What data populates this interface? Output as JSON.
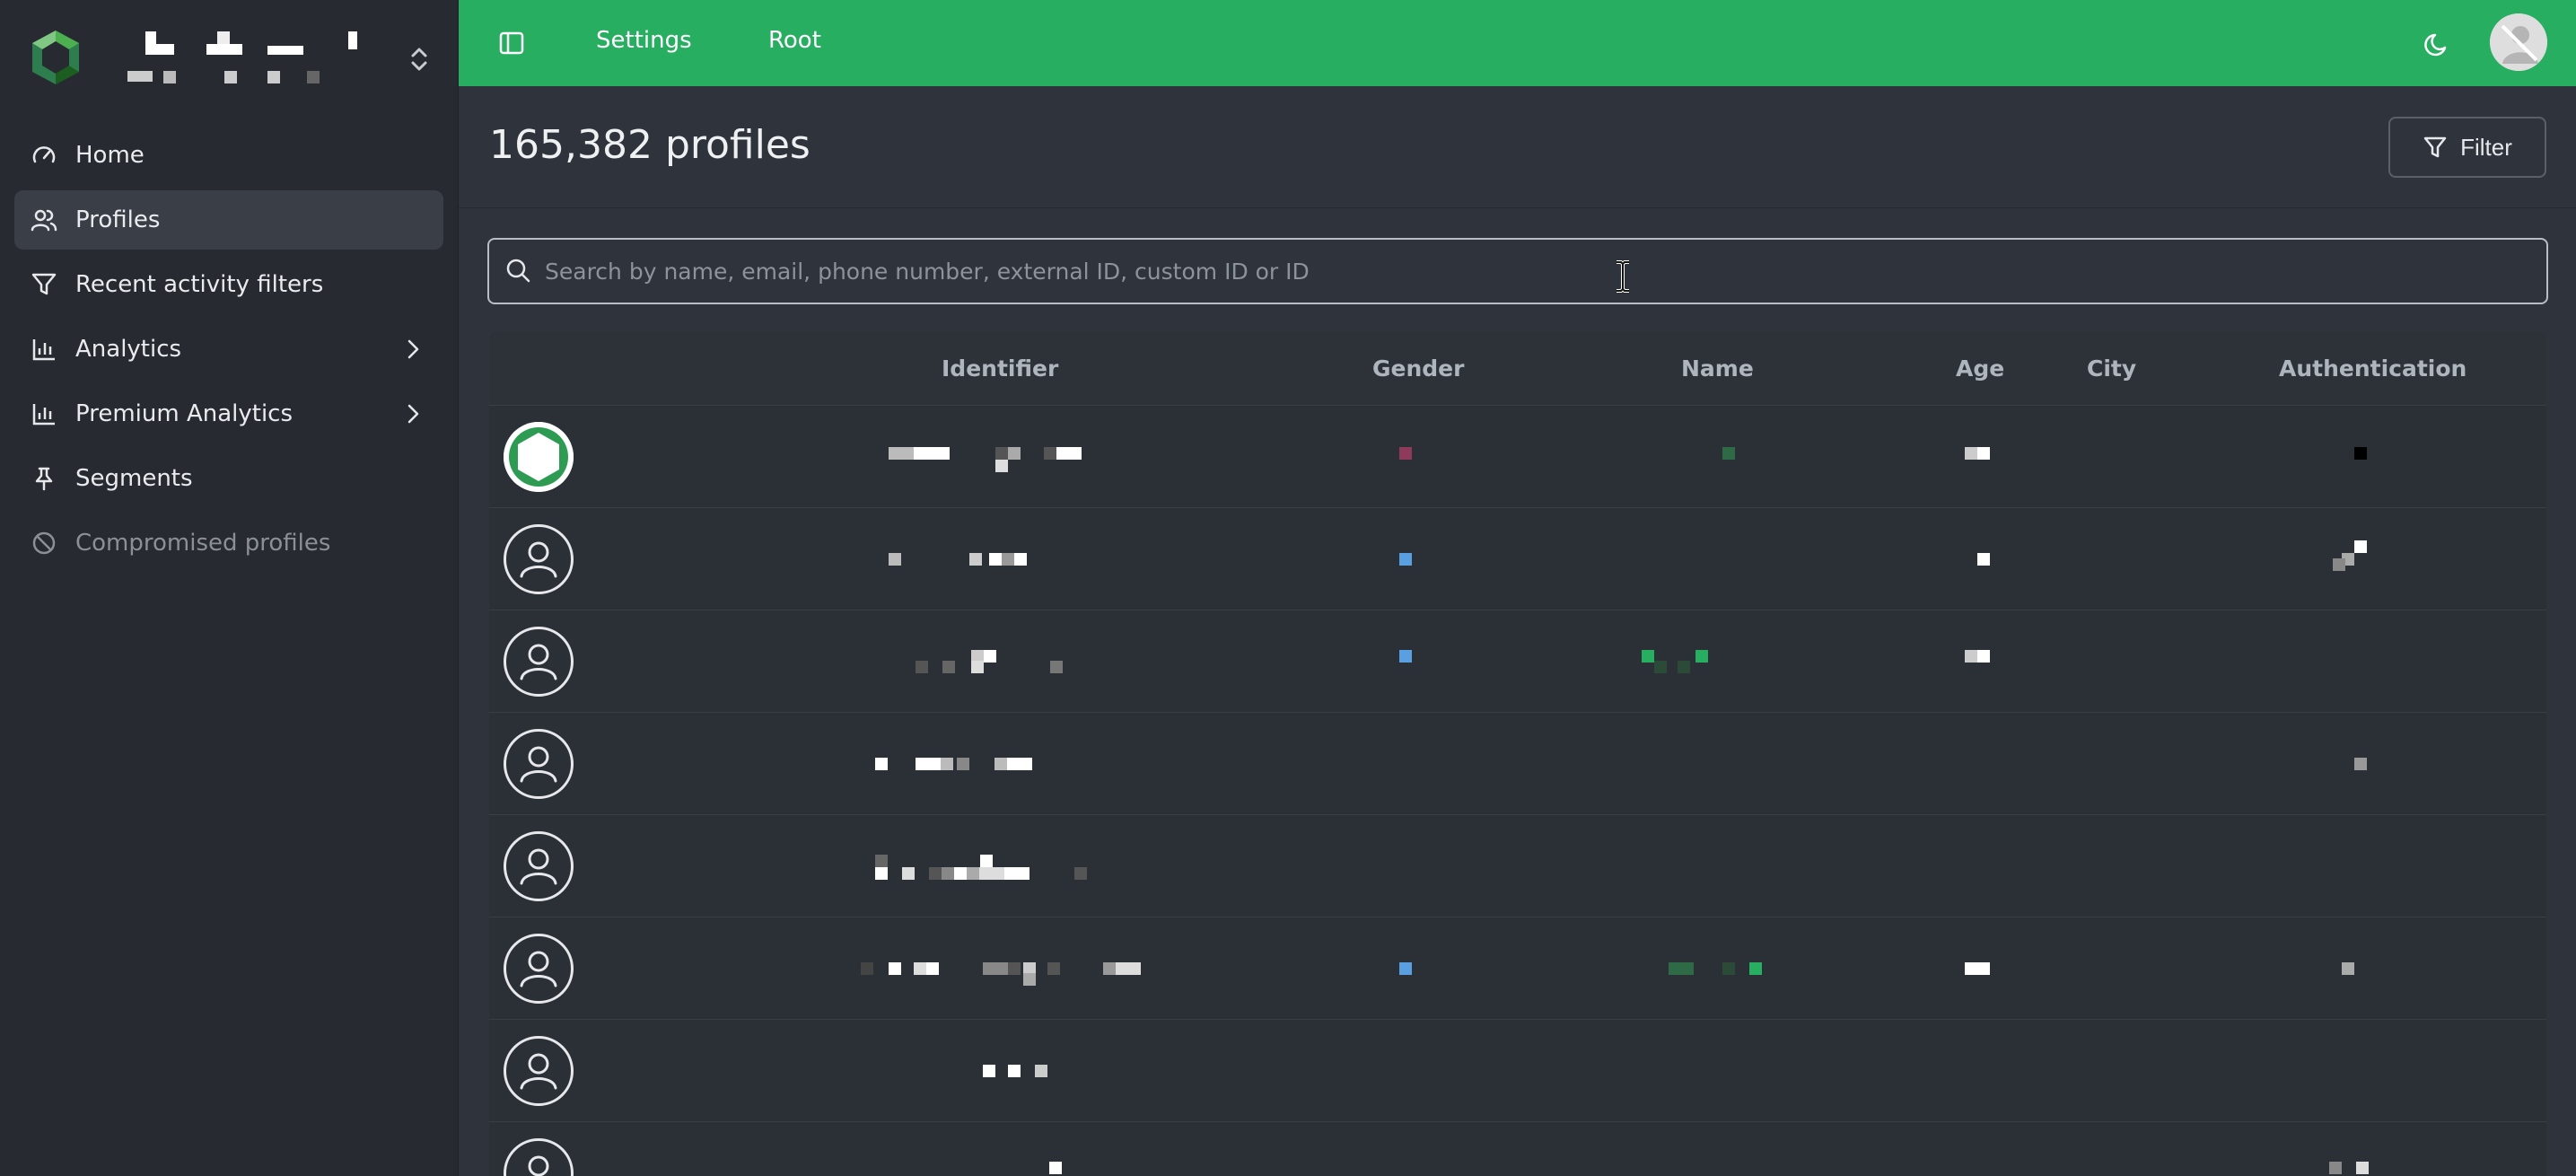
{
  "topbar": {
    "settings_label": "Settings",
    "root_label": "Root"
  },
  "sidebar": {
    "items": [
      {
        "label": "Home",
        "icon": "gauge-icon"
      },
      {
        "label": "Profiles",
        "icon": "users-icon"
      },
      {
        "label": "Recent activity filters",
        "icon": "filter-icon"
      },
      {
        "label": "Analytics",
        "icon": "bar-chart-icon"
      },
      {
        "label": "Premium Analytics",
        "icon": "bar-chart-icon"
      },
      {
        "label": "Segments",
        "icon": "pin-icon"
      },
      {
        "label": "Compromised profiles",
        "icon": "ban-icon"
      }
    ]
  },
  "page": {
    "title": "165,382 profiles",
    "filter_label": "Filter"
  },
  "search": {
    "placeholder": "Search by name, email, phone number, external ID, custom ID or ID",
    "value": ""
  },
  "table": {
    "columns": [
      "Identifier",
      "Gender",
      "Name",
      "Age",
      "City",
      "Authentication"
    ]
  },
  "colors": {
    "accent": "#27ae60",
    "sidebar_bg": "#272a30",
    "content_bg": "#2f333b"
  }
}
